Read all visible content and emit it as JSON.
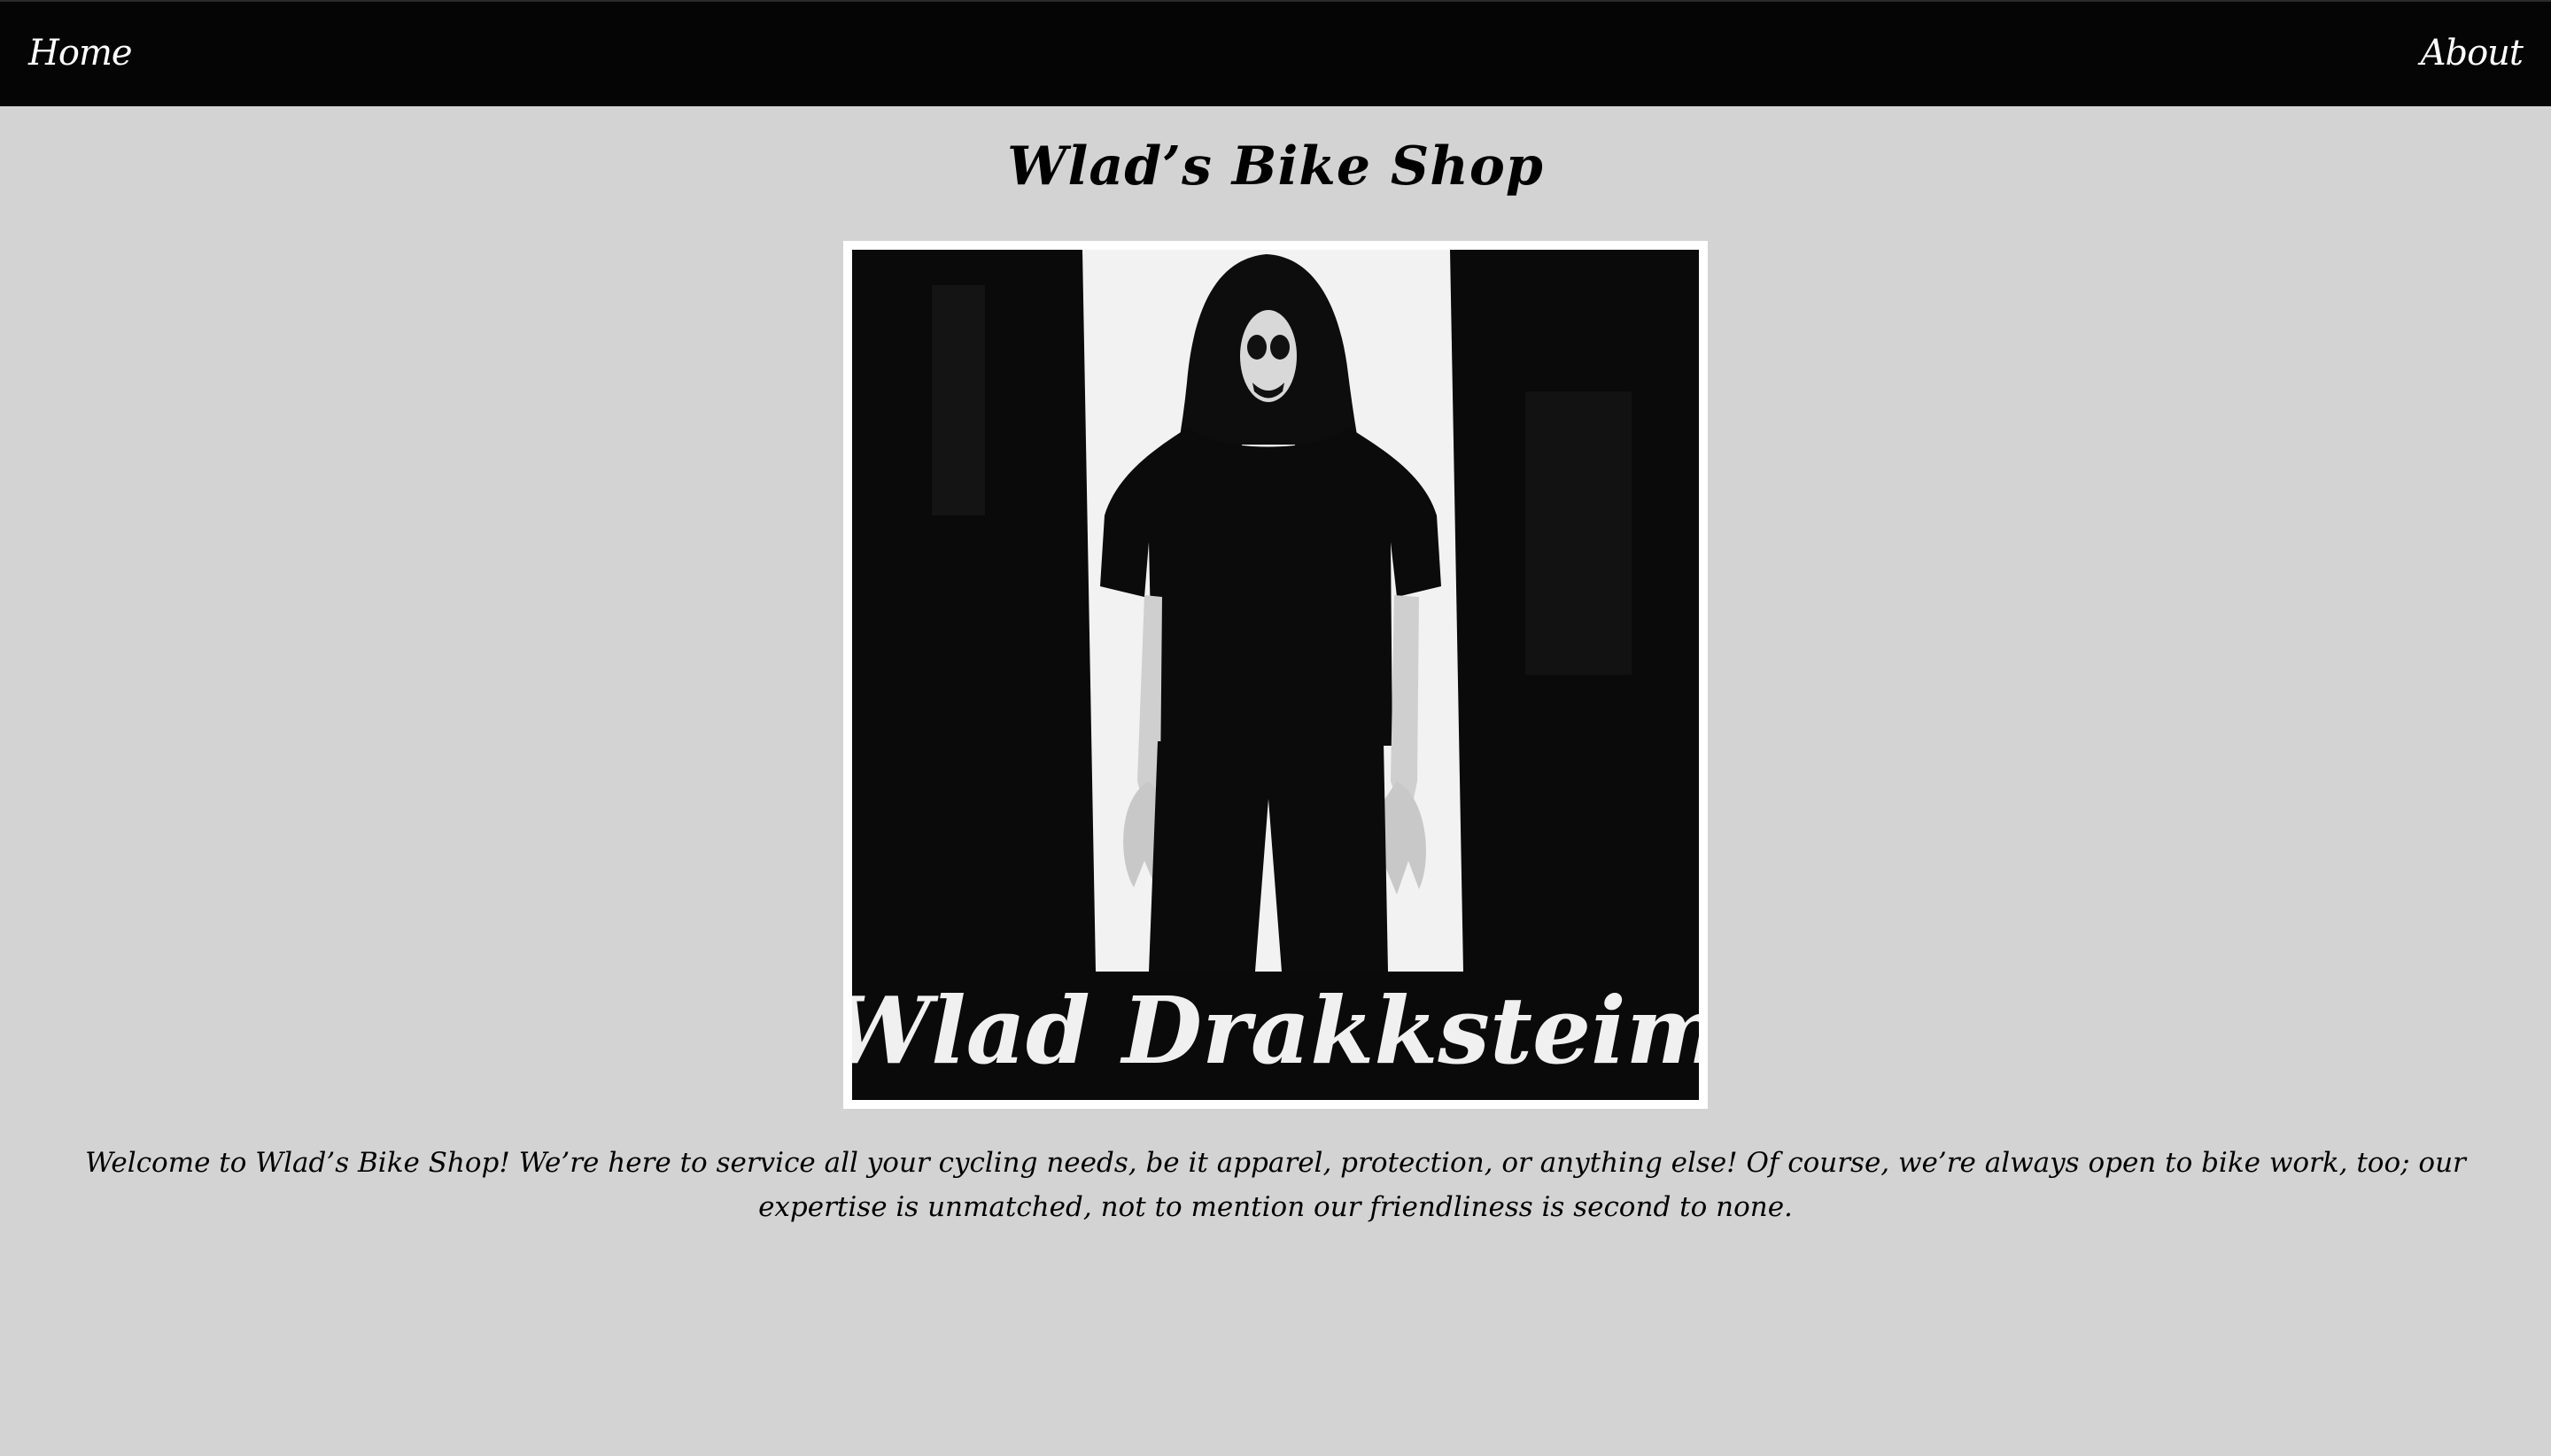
{
  "nav": {
    "home_label": "Home",
    "about_label": "About"
  },
  "page": {
    "title": "Wlad’s Bike Shop"
  },
  "hero": {
    "caption": "Wlad Drakksteim"
  },
  "content": {
    "welcome": "Welcome to Wlad’s Bike Shop! We’re here to service all your cycling needs, be it apparel, protection, or anything else! Of course, we’re always open to bike work, too; our expertise is unmatched, not to mention our friendliness is second to none."
  },
  "colors": {
    "page_background": "#d3d3d3",
    "navbar_background": "#050505",
    "nav_text": "#ffffff",
    "body_text": "#000000"
  }
}
